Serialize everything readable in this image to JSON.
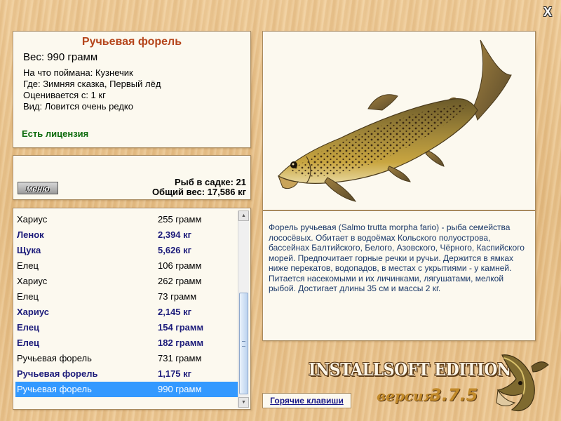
{
  "window": {
    "close_label": "X"
  },
  "fish": {
    "title": "Ручьевая форель",
    "weight": "Вес: 990 грамм",
    "caught_on": "На что поймана: Кузнечик",
    "location": "Где: Зимняя сказка, Первый лёд",
    "min_weight": "Оценивается с: 1 кг",
    "rarity": "Вид: Ловится очень редко",
    "license": "Есть лицензия",
    "description": "Форель ручьевая (Salmo trutta morpha fario) - рыба семейства лососёвых. Обитает в водоёмах Кольского полуострова, бассейнах Балтийского, Белого, Азовского, Чёрного, Каспийского морей. Предпочитает горные речки и ручьи. Держится в ямках ниже перекатов, водопадов, в местах с укрытиями - у камней. Питается насекомыми и их личинками, лягушатами, мелкой рыбой. Достигает длины 35 см и массы 2 кг."
  },
  "summary": {
    "menu_label": "меню",
    "catch_count": "Рыб в садке: 21",
    "total_weight": "Общий вес: 17,586 кг"
  },
  "catch_list": [
    {
      "name": "Хариус",
      "weight": "255 грамм",
      "bold": false,
      "selected": false
    },
    {
      "name": "Ленок",
      "weight": "2,394 кг",
      "bold": true,
      "selected": false
    },
    {
      "name": "Щука",
      "weight": "5,626 кг",
      "bold": true,
      "selected": false
    },
    {
      "name": "Елец",
      "weight": "106 грамм",
      "bold": false,
      "selected": false
    },
    {
      "name": "Хариус",
      "weight": "262 грамм",
      "bold": false,
      "selected": false
    },
    {
      "name": "Елец",
      "weight": "73 грамм",
      "bold": false,
      "selected": false
    },
    {
      "name": "Хариус",
      "weight": "2,145 кг",
      "bold": true,
      "selected": false
    },
    {
      "name": "Елец",
      "weight": "154 грамм",
      "bold": true,
      "selected": false
    },
    {
      "name": "Елец",
      "weight": "182 грамм",
      "bold": true,
      "selected": false
    },
    {
      "name": "Ручьевая форель",
      "weight": "731 грамм",
      "bold": false,
      "selected": false
    },
    {
      "name": "Ручьевая форель",
      "weight": "1,175 кг",
      "bold": true,
      "selected": false
    },
    {
      "name": "Ручьевая форель",
      "weight": "990 грамм",
      "bold": false,
      "selected": true
    }
  ],
  "footer": {
    "hotkeys_label": "Горячие клавиши",
    "edition": "INSTALLSOFT EDITION",
    "version_label": "версия",
    "version_number": "3.7.5"
  },
  "icons": {
    "close": "close-icon",
    "fish_image": "brown-trout-image",
    "logo": "pike-logo-icon",
    "scroll_up": "arrow-up-icon",
    "scroll_down": "arrow-down-icon"
  },
  "colors": {
    "title": "#b5451b",
    "license": "#0b6a0b",
    "bold_row": "#1c1b7a",
    "selection": "#3399ff",
    "description": "#1a3868",
    "panel": "#fcf9ef"
  }
}
